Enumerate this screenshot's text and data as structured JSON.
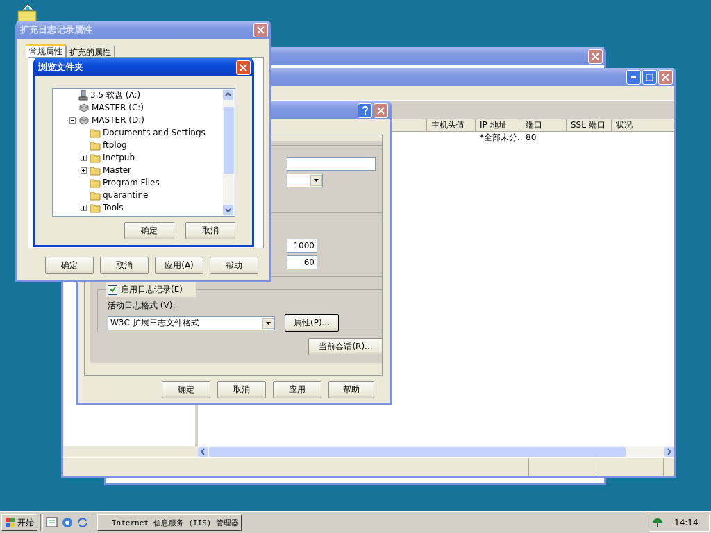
{
  "logging_dialog": {
    "title": "扩充日志记录属性",
    "tabs": [
      {
        "label": "常规属性",
        "selected": true
      },
      {
        "label": "扩充的属性",
        "selected": false
      }
    ],
    "buttons": [
      "确定",
      "取消",
      "应用(A)",
      "帮助"
    ]
  },
  "browse_dialog": {
    "title": "浏览文件夹",
    "tree": [
      {
        "kind": "floppy",
        "label": "3.5 软盘 (A:)",
        "expandable": false
      },
      {
        "kind": "disk",
        "label": "MASTER (C:)",
        "expandable": false
      },
      {
        "kind": "disk",
        "label": "MASTER (D:)",
        "expandable": true,
        "expanded": true,
        "children": [
          {
            "kind": "folder",
            "label": "Documents and Settings",
            "expandable": false
          },
          {
            "kind": "folder",
            "label": "ftplog",
            "expandable": false
          },
          {
            "kind": "folder",
            "label": "Inetpub",
            "expandable": true,
            "expanded": false
          },
          {
            "kind": "folder",
            "label": "Master",
            "expandable": true,
            "expanded": false
          },
          {
            "kind": "folder",
            "label": "Program Flies",
            "expandable": false
          },
          {
            "kind": "folder",
            "label": "quarantine",
            "expandable": false
          },
          {
            "kind": "folder",
            "label": "Tools",
            "expandable": true,
            "expanded": false
          }
        ]
      }
    ],
    "buttons": [
      "确定",
      "取消"
    ]
  },
  "iis_window": {
    "list": {
      "columns": [
        "主机头值",
        "IP 地址",
        "端口",
        "SSL 端口",
        "状况"
      ],
      "rows": [
        {
          "ip_address": "*全部未分..",
          "port": "80"
        }
      ]
    }
  },
  "site_dialog": {
    "limits": {
      "value_1": "1000",
      "value_2": "60"
    },
    "logging": {
      "checked": true,
      "enable_label": "启用日志记录(E)",
      "format_label": "活动日志格式 (V):",
      "format": "W3C 扩展日志文件格式",
      "properties_button": "属性(P)..."
    },
    "current_sessions_button": "当前会话(R)...",
    "buttons": [
      "确定",
      "取消",
      "应用",
      "帮助"
    ]
  },
  "taskbar": {
    "start": "开始",
    "tasks": [
      "Internet 信息服务 (IIS) 管理器"
    ],
    "clock": "14:14"
  }
}
